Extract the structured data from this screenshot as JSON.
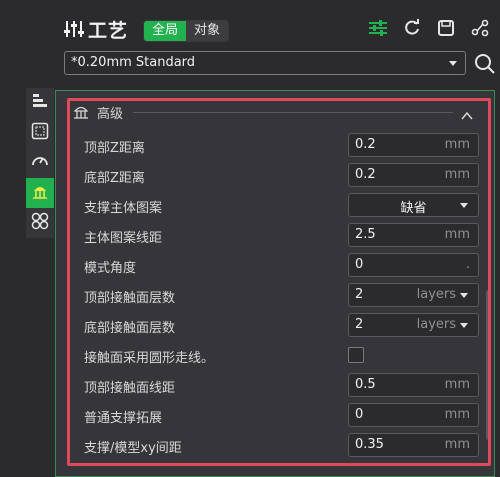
{
  "header": {
    "title": "工艺",
    "scope_tabs": [
      "全局",
      "对象"
    ],
    "active_scope": "全局",
    "tool_icons": [
      "slider-settings-icon",
      "refresh-icon",
      "save-icon",
      "compare-icon"
    ]
  },
  "preset": {
    "value": "*0.20mm Standard"
  },
  "side_tabs": [
    "quality-icon",
    "strength-icon",
    "speed-icon",
    "support-icon",
    "others-icon"
  ],
  "section": {
    "title": "高级"
  },
  "rows": [
    {
      "label": "顶部Z距离",
      "value": "0.2",
      "unit": "mm",
      "kind": "number"
    },
    {
      "label": "底部Z距离",
      "value": "0.2",
      "unit": "mm",
      "kind": "number"
    },
    {
      "label": "支撑主体图案",
      "value": "缺省",
      "unit": "",
      "kind": "select"
    },
    {
      "label": "主体图案线距",
      "value": "2.5",
      "unit": "mm",
      "kind": "number"
    },
    {
      "label": "模式角度",
      "value": "0",
      "unit": ".",
      "kind": "number"
    },
    {
      "label": "顶部接触面层数",
      "value": "2",
      "unit": "layers",
      "kind": "combo"
    },
    {
      "label": "底部接触面层数",
      "value": "2",
      "unit": "layers",
      "kind": "combo"
    },
    {
      "label": "接触面采用圆形走线。",
      "value": "",
      "unit": "",
      "kind": "checkbox"
    },
    {
      "label": "顶部接触面线距",
      "value": "0.5",
      "unit": "mm",
      "kind": "number"
    },
    {
      "label": "普通支撑拓展",
      "value": "0",
      "unit": "mm",
      "kind": "number"
    },
    {
      "label": "支撑/模型xy间距",
      "value": "0.35",
      "unit": "mm",
      "kind": "number"
    }
  ],
  "colors": {
    "accent": "#21b14f",
    "highlight": "#e0485b",
    "background": "#2b2b2e",
    "panel": "#36363a"
  }
}
